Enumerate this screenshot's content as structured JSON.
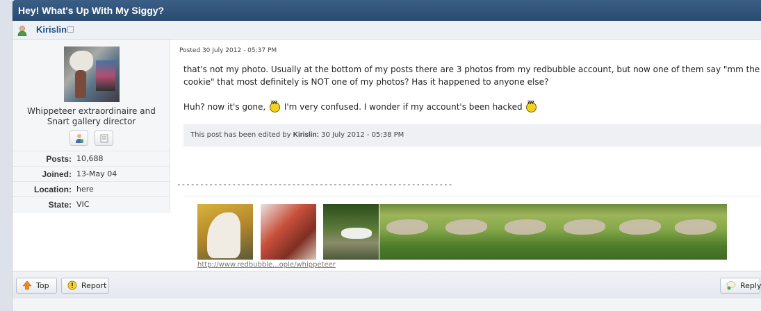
{
  "topic": {
    "title": "Hey! What's Up With My Siggy?"
  },
  "author": {
    "name": "Kirislin",
    "icon": "user-icon",
    "external_icon": "external-link-icon"
  },
  "profile": {
    "title": "Whippeteer extraordinaire and Snart gallery director",
    "buttons": [
      {
        "icon": "add-friend-icon"
      },
      {
        "icon": "send-message-icon"
      }
    ],
    "stats": [
      {
        "key": "Posts:",
        "value": "10,688"
      },
      {
        "key": "Joined:",
        "value": "13-May 04"
      },
      {
        "key": "Location:",
        "value": "here"
      },
      {
        "key": "State:",
        "value": "VIC"
      }
    ]
  },
  "post": {
    "posted": "Posted 30 July 2012 - 05:37 PM",
    "line1": "that's not my photo. Usually at the bottom of my posts there are 3 photos from my redbubble account, but now one of them say \"mm the atomic s",
    "line2": "cookie\" that most definitely is NOT one of my photos? Has it happened to anyone else?",
    "line3a": "Huh? now it's gone,",
    "line3b": "I'm very confused. I wonder if my account's been hacked",
    "edited_prefix": "This post has been edited by",
    "edited_by": "Kirislin:",
    "edited_date": "30 July 2012 - 05:38 PM"
  },
  "signature": {
    "separator": "------------------------------------------------------------",
    "link": "http://www.redbubble...ople/whippeteer"
  },
  "footer": {
    "top": "Top",
    "report": "Report",
    "reply": "Reply"
  },
  "colors": {
    "header": "#2f527a",
    "author": "#1c4a7c",
    "smiley": "#f3d21a"
  }
}
